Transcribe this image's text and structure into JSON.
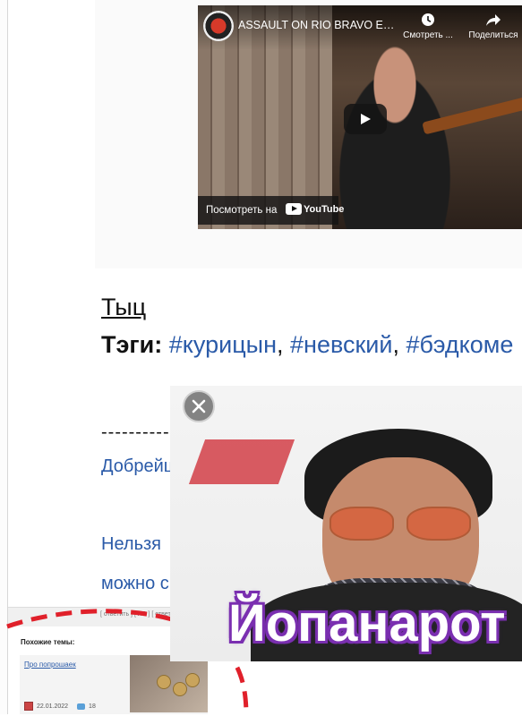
{
  "video": {
    "title": "ASSAULT ON RIO BRAVO Exc...",
    "watch_later_label": "Смотреть ...",
    "share_label": "Поделиться",
    "watch_on_label": "Посмотреть на",
    "youtube_label": "YouTube"
  },
  "post": {
    "link_text": "Тыц",
    "tags_label": "Тэги:",
    "tags": [
      "#курицын",
      "#невский",
      "#бэдкоме"
    ],
    "separator": ",",
    "dashes": "-----------",
    "greeting": "Добрейш",
    "line1": "Нельзя",
    "line2": "можно с"
  },
  "popup": {
    "caption": "Йопанарот"
  },
  "bottom_strip": {
    "links": "[ ответить ] [ ЛС ] [ ответить ]"
  },
  "related": {
    "heading": "Похожие темы:",
    "items": [
      {
        "title": "Про попрошаек",
        "date": "22.01.2022",
        "comments": "18"
      }
    ]
  },
  "colors": {
    "link_blue": "#2a5aa8",
    "caption_outline": "#7a2fb0",
    "annotation_red": "#e0202a"
  }
}
